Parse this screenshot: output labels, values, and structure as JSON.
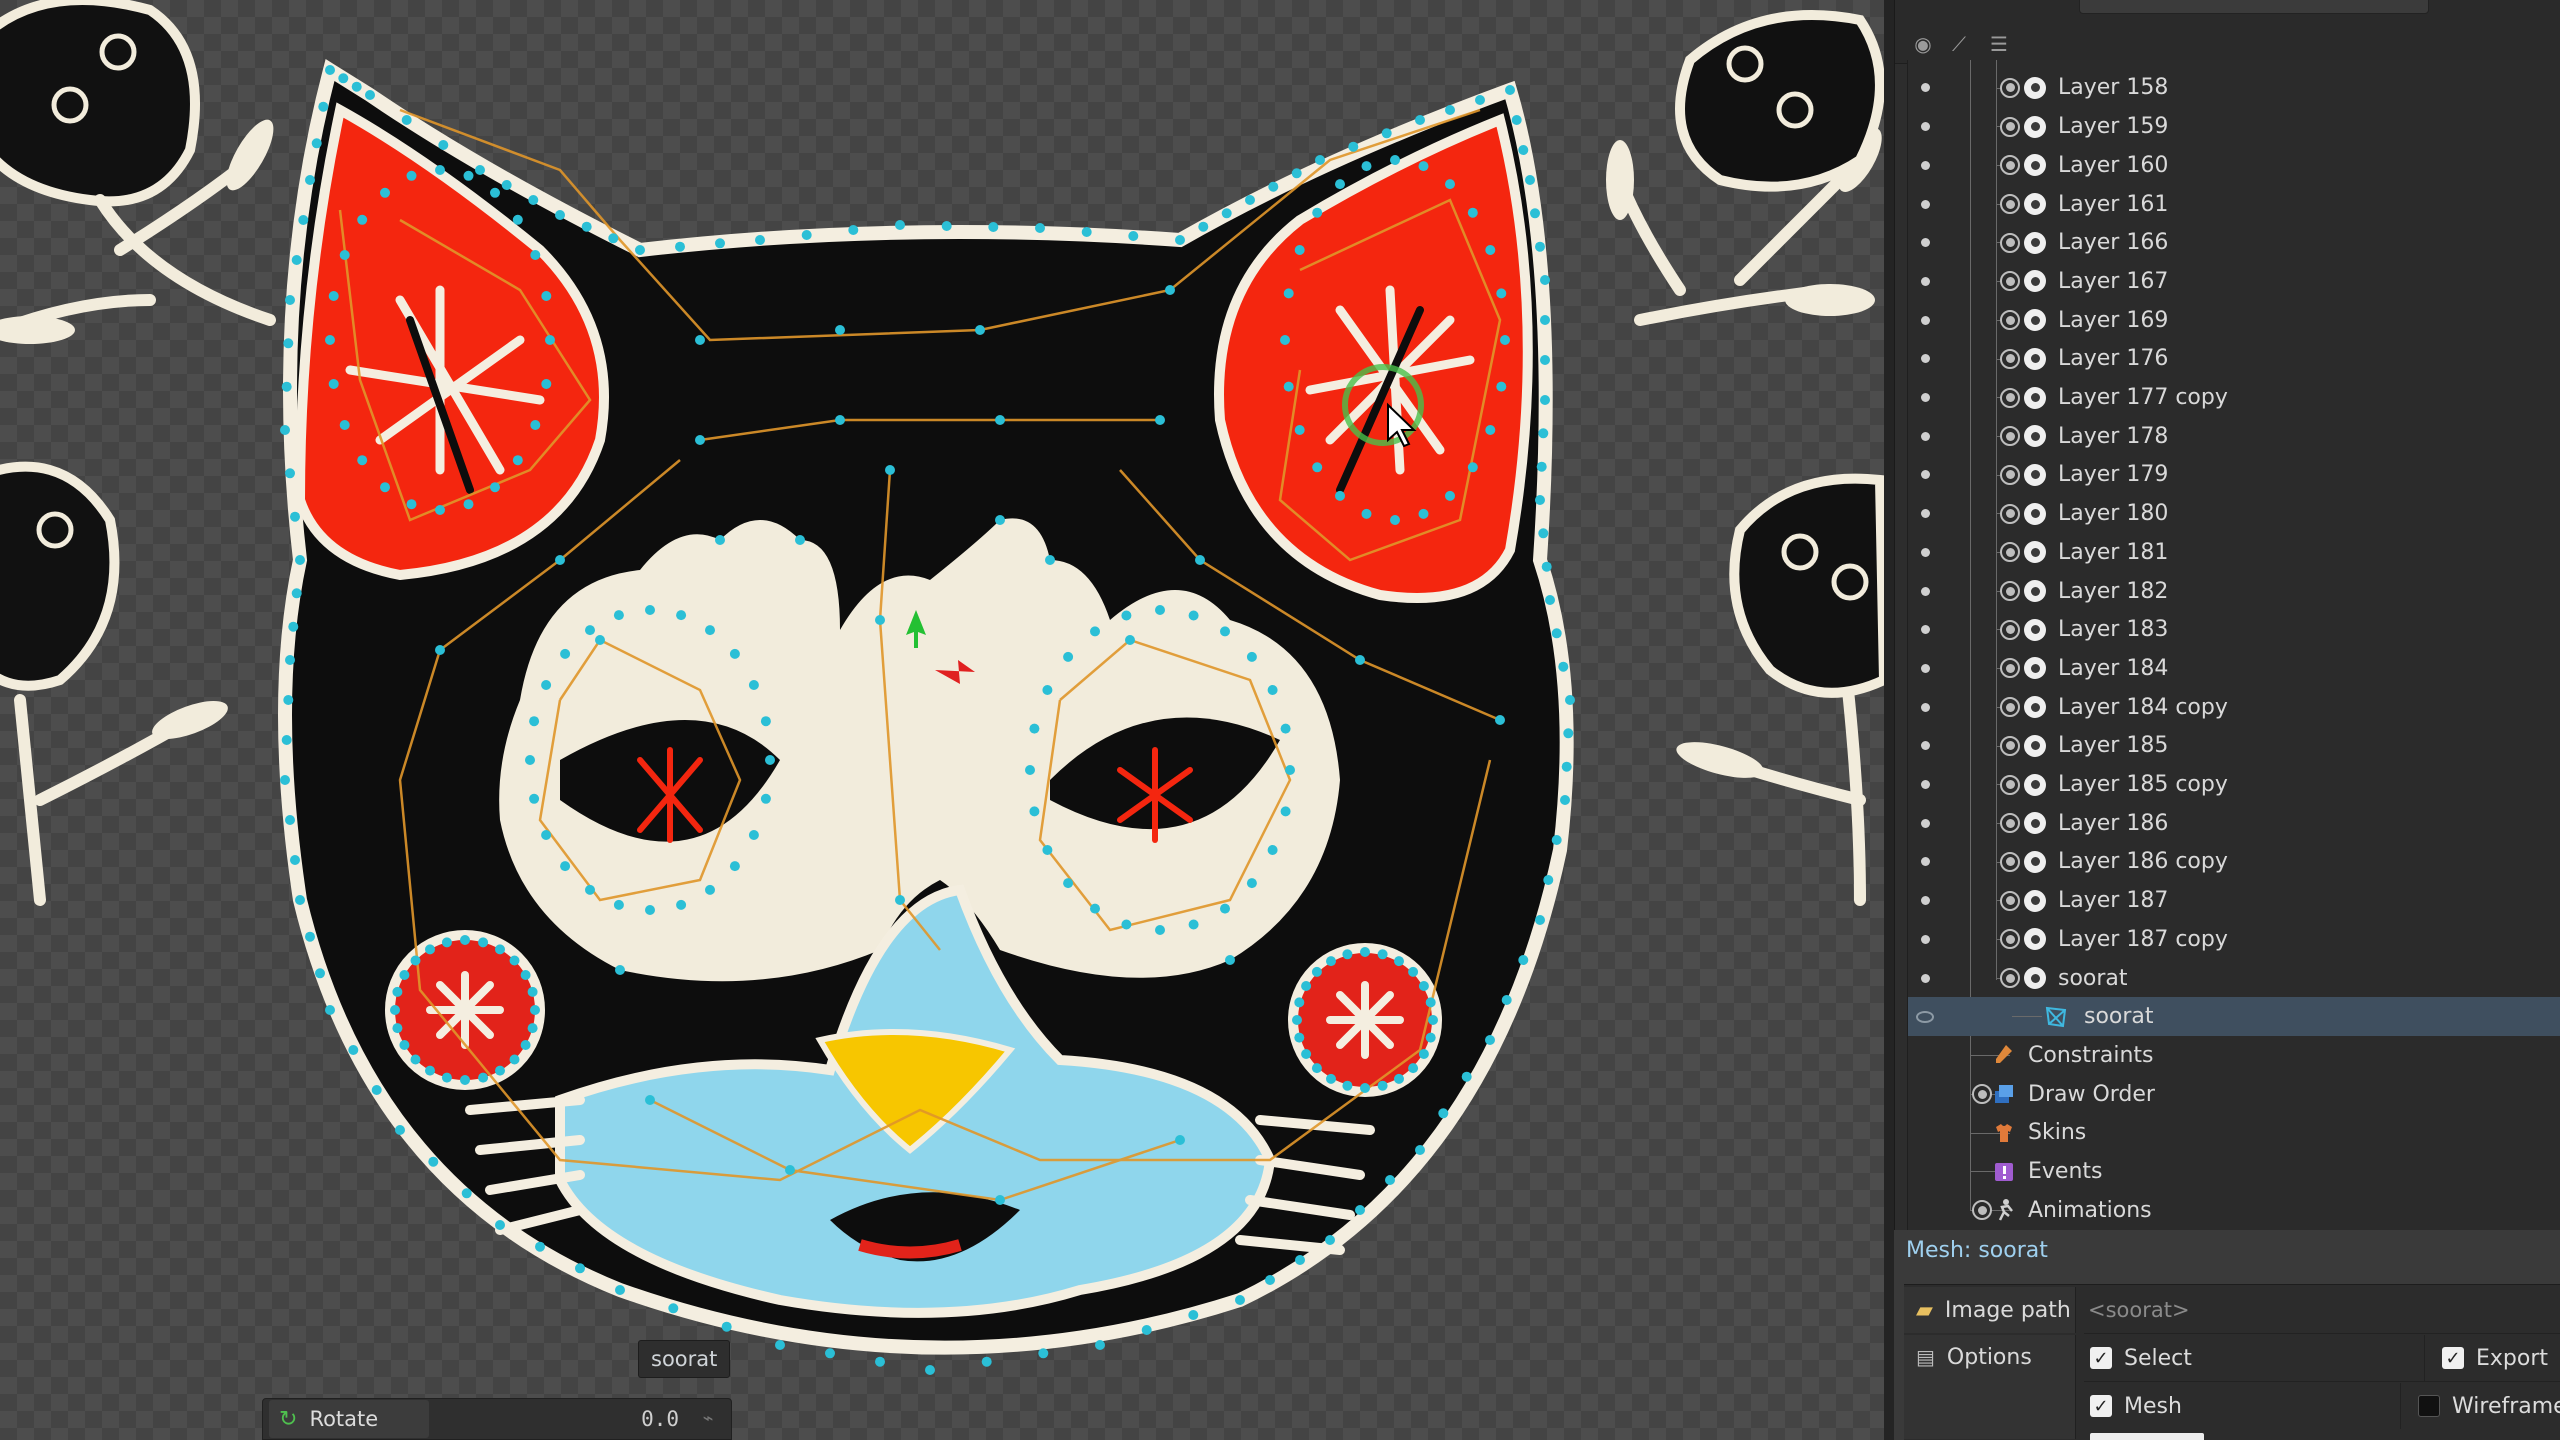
{
  "viewport": {
    "tooltip": "soorat",
    "rotate_label": "Rotate",
    "rotate_value": "0.0"
  },
  "tree": {
    "layers": [
      "Layer 158",
      "Layer 159",
      "Layer 160",
      "Layer 161",
      "Layer 166",
      "Layer 167",
      "Layer 169",
      "Layer 176",
      "Layer 177 copy",
      "Layer 178",
      "Layer 179",
      "Layer 180",
      "Layer 181",
      "Layer 182",
      "Layer 183",
      "Layer 184",
      "Layer 184 copy",
      "Layer 185",
      "Layer 185 copy",
      "Layer 186",
      "Layer 186 copy",
      "Layer 187",
      "Layer 187 copy"
    ],
    "slot_label": "soorat",
    "mesh_label": "soorat",
    "sections": [
      {
        "label": "Constraints",
        "icon": "constraints-icon",
        "color": "#e0883a"
      },
      {
        "label": "Draw Order",
        "icon": "draw-order-icon",
        "color": "#4a90d9"
      },
      {
        "label": "Skins",
        "icon": "skins-icon",
        "color": "#e07a3a"
      },
      {
        "label": "Events",
        "icon": "events-icon",
        "color": "#a05cd0"
      },
      {
        "label": "Animations",
        "icon": "animations-icon",
        "color": "#cfcfcf"
      }
    ]
  },
  "properties": {
    "title": "Mesh: soorat",
    "image_path_label": "Image path",
    "image_path_value": "<soorat>",
    "options_label": "Options",
    "select_label": "Select",
    "select_checked": true,
    "export_label": "Export",
    "export_checked": true,
    "mesh_label": "Mesh",
    "mesh_checked": true,
    "wireframe_label": "Wireframe",
    "wireframe_checked": false
  },
  "colors": {
    "selection": "#3f4f5f",
    "accent_title": "#9fd0ef",
    "mesh_vertex": "#2bbfd6",
    "mesh_edge": "#e0962a"
  }
}
